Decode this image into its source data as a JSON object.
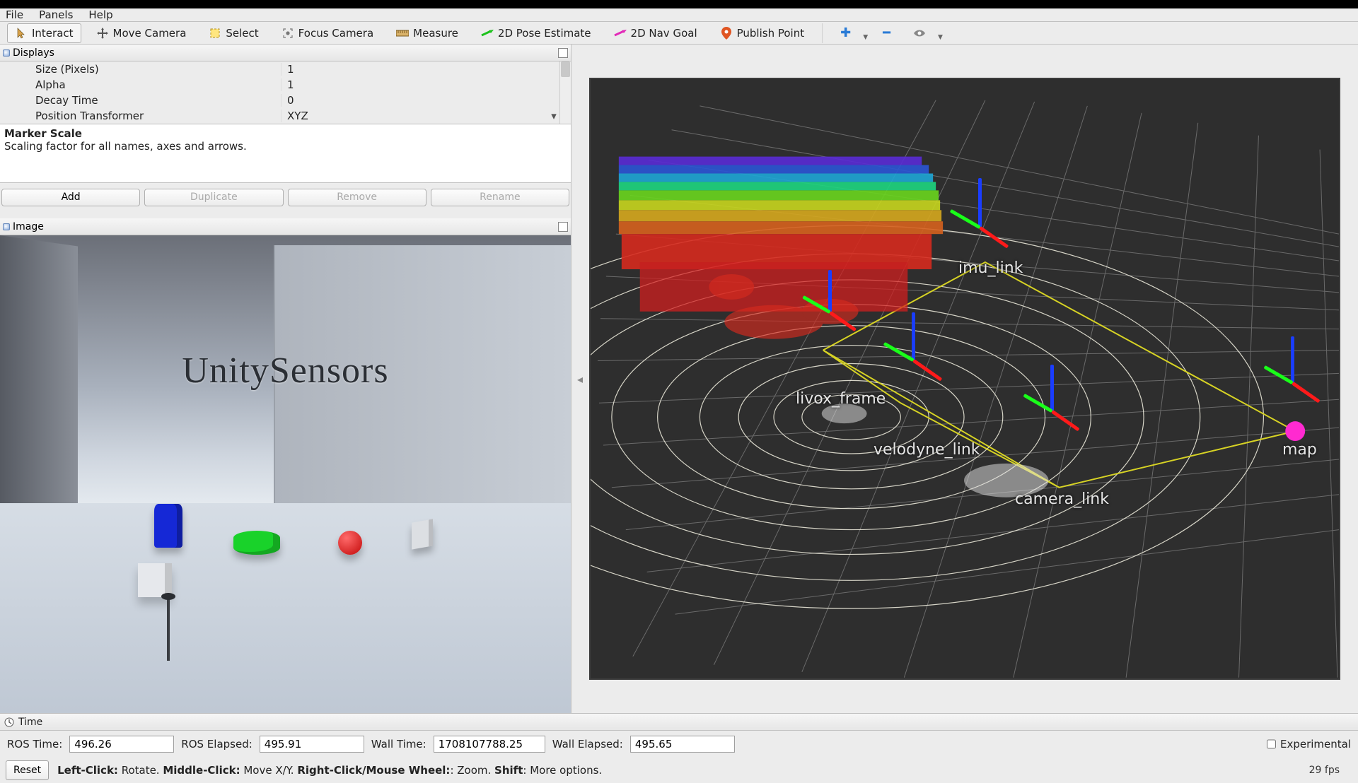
{
  "menu": {
    "file": "File",
    "panels": "Panels",
    "help": "Help"
  },
  "toolbar": {
    "interact": "Interact",
    "move_camera": "Move Camera",
    "select": "Select",
    "focus_camera": "Focus Camera",
    "measure": "Measure",
    "pose_estimate": "2D Pose Estimate",
    "nav_goal": "2D Nav Goal",
    "publish_point": "Publish Point"
  },
  "panels": {
    "displays_title": "Displays",
    "image_title": "Image",
    "time_title": "Time"
  },
  "displays": {
    "rows": [
      {
        "k": "Size (Pixels)",
        "v": "1"
      },
      {
        "k": "Alpha",
        "v": "1"
      },
      {
        "k": "Decay Time",
        "v": "0"
      },
      {
        "k": "Position Transformer",
        "v": "XYZ",
        "dd": true
      }
    ],
    "desc_title": "Marker Scale",
    "desc_body": "Scaling factor for all names, axes and arrows.",
    "buttons": {
      "add": "Add",
      "duplicate": "Duplicate",
      "remove": "Remove",
      "rename": "Rename"
    }
  },
  "image_panel": {
    "scene_text": "UnitySensors"
  },
  "view3d": {
    "frames": [
      "imu_link",
      "livox_frame",
      "velodyne_link",
      "camera_link",
      "map"
    ]
  },
  "time": {
    "ros_time_label": "ROS Time:",
    "ros_time": "496.26",
    "ros_elapsed_label": "ROS Elapsed:",
    "ros_elapsed": "495.91",
    "wall_time_label": "Wall Time:",
    "wall_time": "1708107788.25",
    "wall_elapsed_label": "Wall Elapsed:",
    "wall_elapsed": "495.65",
    "experimental": "Experimental",
    "reset": "Reset",
    "fps": "29 fps",
    "hint_left_b": "Left-Click:",
    "hint_left": " Rotate. ",
    "hint_mid_b": "Middle-Click:",
    "hint_mid": " Move X/Y. ",
    "hint_right_b": "Right-Click/Mouse Wheel:",
    "hint_right": ": Zoom. ",
    "hint_shift_b": "Shift",
    "hint_shift": ": More options."
  }
}
